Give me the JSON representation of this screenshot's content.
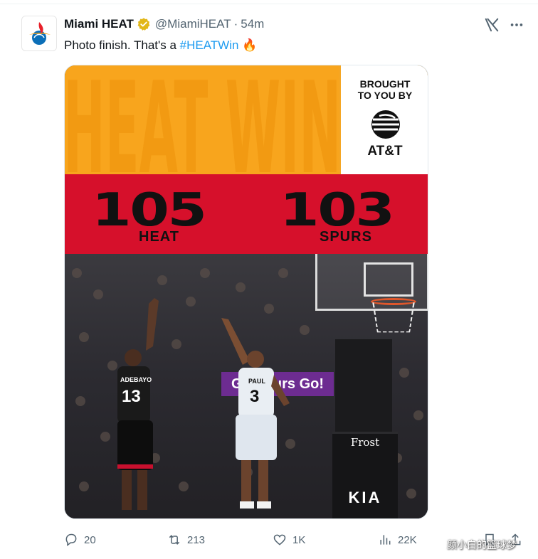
{
  "tweet": {
    "author_name": "Miami HEAT",
    "handle": "@MiamiHEAT",
    "separator": "·",
    "time": "54m",
    "text_prefix": "Photo finish. That's a ",
    "hashtag": "#HEATWin",
    "emoji": "🔥"
  },
  "graphic": {
    "title": "HEAT WIN",
    "sponsor_line1": "BROUGHT",
    "sponsor_line2": "TO YOU BY",
    "sponsor_name": "AT&T",
    "home_score": "105",
    "home_team": "HEAT",
    "away_score": "103",
    "away_team": "SPURS",
    "arena_banner": "Go Spurs Go!",
    "stanchion_brand": "Frost",
    "floor_brand": "KIA",
    "player1_name": "ADEBAYO",
    "player1_number": "13",
    "player2_name": "PAUL",
    "player2_number": "3"
  },
  "actions": {
    "replies": "20",
    "reposts": "213",
    "likes": "1K",
    "views": "22K"
  },
  "watermark": "颜小白的篮球梦",
  "colors": {
    "hashtag": "#1d9bf0",
    "heat_orange": "#f8a51d",
    "heat_red": "#d6102b",
    "verified_gold": "#e2b719"
  }
}
